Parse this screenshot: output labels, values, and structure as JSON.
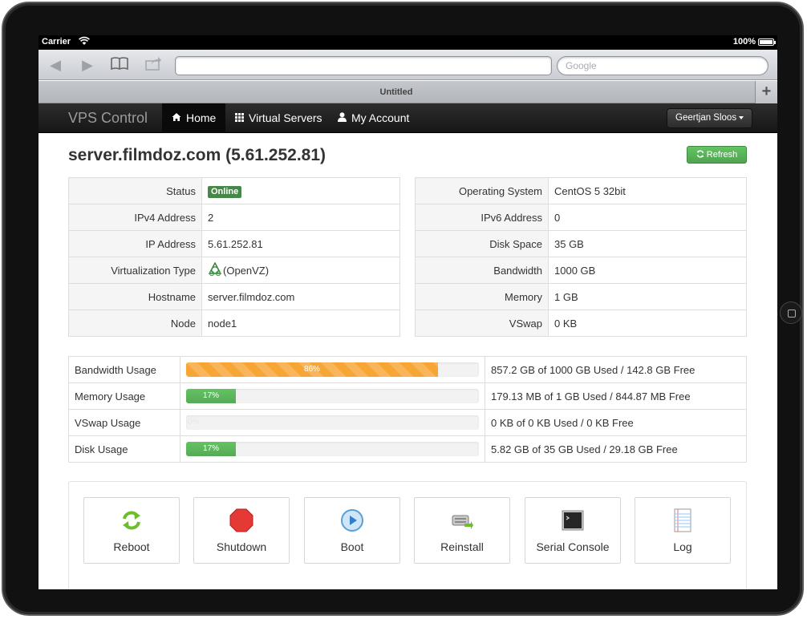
{
  "statusbar": {
    "carrier": "Carrier",
    "battery": "100%"
  },
  "browser": {
    "search_placeholder": "Google",
    "tab_title": "Untitled",
    "new_tab": "+"
  },
  "nav": {
    "brand": "VPS Control",
    "items": [
      {
        "label": "Home",
        "icon": "home-icon"
      },
      {
        "label": "Virtual Servers",
        "icon": "grid-icon"
      },
      {
        "label": "My Account",
        "icon": "user-icon"
      }
    ],
    "user": "Geertjan Sloos"
  },
  "page": {
    "title": "server.filmdoz.com (5.61.252.81)",
    "refresh_label": "Refresh"
  },
  "info_left": [
    {
      "key": "Status",
      "value": "Online"
    },
    {
      "key": "IPv4 Address",
      "value": "2"
    },
    {
      "key": "IP Address",
      "value": "5.61.252.81"
    },
    {
      "key": "Virtualization Type",
      "value": "(OpenVZ)"
    },
    {
      "key": "Hostname",
      "value": "server.filmdoz.com"
    },
    {
      "key": "Node",
      "value": "node1"
    }
  ],
  "info_right": [
    {
      "key": "Operating System",
      "value": "CentOS 5 32bit"
    },
    {
      "key": "IPv6 Address",
      "value": "0"
    },
    {
      "key": "Disk Space",
      "value": "35 GB"
    },
    {
      "key": "Bandwidth",
      "value": "1000 GB"
    },
    {
      "key": "Memory",
      "value": "1 GB"
    },
    {
      "key": "VSwap",
      "value": "0 KB"
    }
  ],
  "usage": [
    {
      "label": "Bandwidth Usage",
      "percent": 86,
      "percent_label": "86%",
      "color": "#f7a534",
      "detail": "857.2 GB of 1000 GB Used / 142.8 GB Free"
    },
    {
      "label": "Memory Usage",
      "percent": 17,
      "percent_label": "17%",
      "color": "#5eb95e",
      "detail": "179.13 MB of 1 GB Used / 844.87 MB Free"
    },
    {
      "label": "VSwap Usage",
      "percent": 0,
      "percent_label": "0%",
      "color": "#5eb95e",
      "detail": "0 KB of 0 KB Used / 0 KB Free"
    },
    {
      "label": "Disk Usage",
      "percent": 17,
      "percent_label": "17%",
      "color": "#5eb95e",
      "detail": "5.82 GB of 35 GB Used / 29.18 GB Free"
    }
  ],
  "actions": [
    {
      "label": "Reboot",
      "icon": "reboot-icon"
    },
    {
      "label": "Shutdown",
      "icon": "shutdown-icon"
    },
    {
      "label": "Boot",
      "icon": "boot-icon"
    },
    {
      "label": "Reinstall",
      "icon": "reinstall-icon"
    },
    {
      "label": "Serial Console",
      "icon": "console-icon"
    },
    {
      "label": "Log",
      "icon": "log-icon"
    }
  ]
}
